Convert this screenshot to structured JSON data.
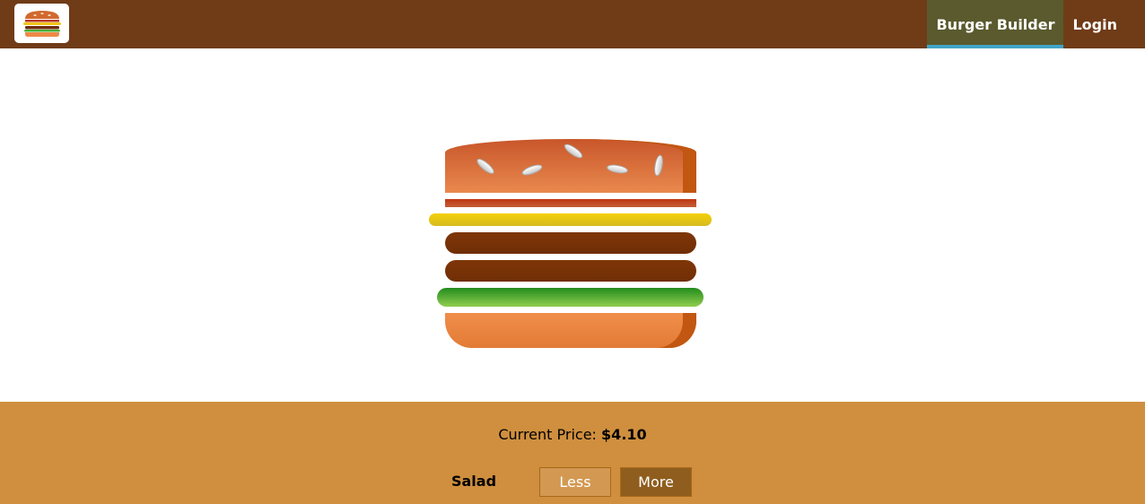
{
  "header": {
    "logo_icon": "burger-logo-icon",
    "nav": [
      {
        "label": "Burger Builder",
        "active": true
      },
      {
        "label": "Login",
        "active": false
      }
    ]
  },
  "burger": {
    "ingredients": [
      "bread-top",
      "bacon",
      "cheese",
      "meat",
      "meat",
      "salad",
      "bread-bottom"
    ]
  },
  "controls": {
    "price_label": "Current Price:",
    "price_value": "$4.10",
    "items": [
      {
        "label": "Salad",
        "less_label": "Less",
        "more_label": "More"
      }
    ]
  },
  "colors": {
    "toolbar": "#703b17",
    "active_nav": "#5a5a2e",
    "active_underline": "#40a4c8",
    "controls_bg": "#cf8f3e",
    "less_button": "#d39952",
    "more_button": "#8f5e1e"
  }
}
